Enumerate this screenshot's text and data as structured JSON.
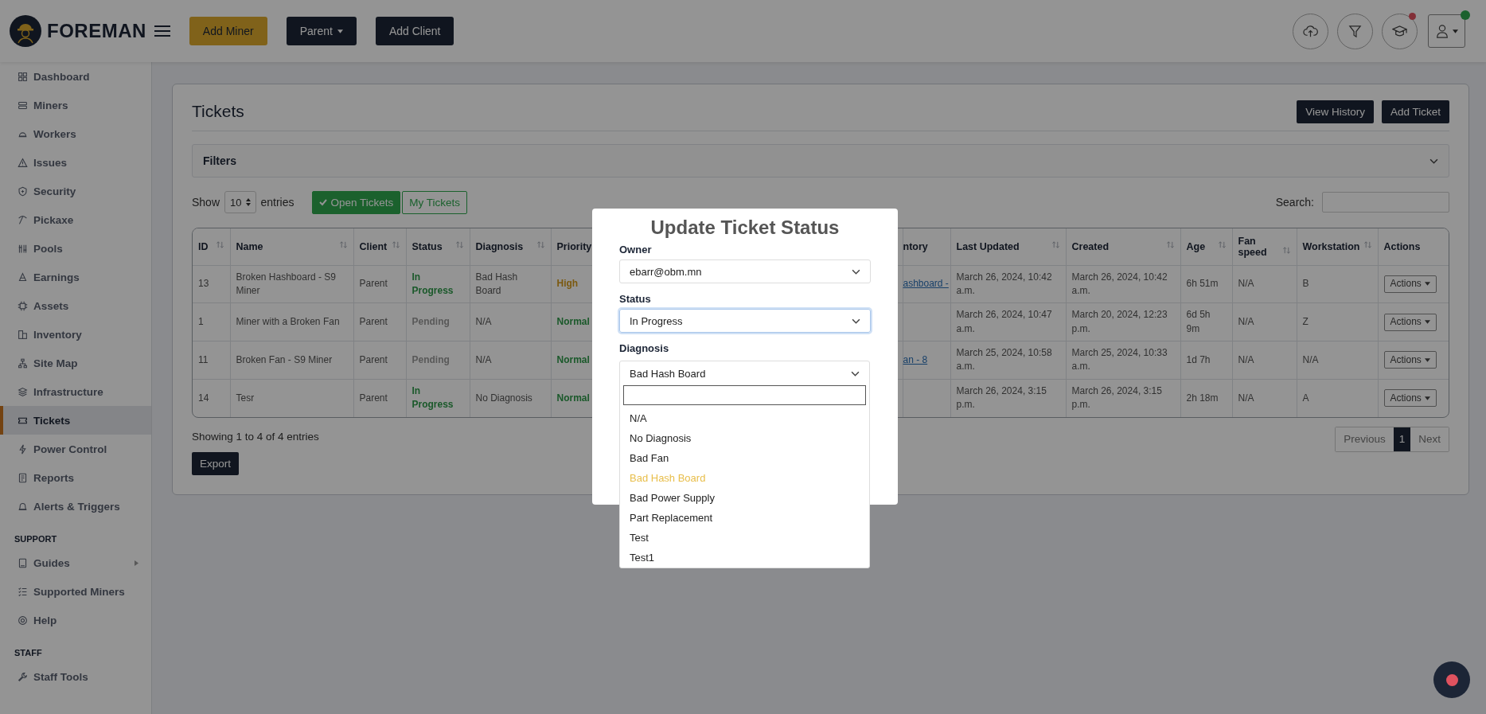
{
  "header": {
    "brand": "FOREMAN",
    "buttons": [
      {
        "label": "Add Miner",
        "kind": "accent"
      },
      {
        "label": "Parent",
        "kind": "dropdown"
      },
      {
        "label": "Add Client",
        "kind": "dark"
      }
    ],
    "notifications": {
      "unread": true
    },
    "user": {
      "online": true
    }
  },
  "sidebar": {
    "sections": [
      {
        "items": [
          {
            "label": "Dashboard",
            "selected": false,
            "expandable": false
          },
          {
            "label": "Miners",
            "selected": false,
            "expandable": false
          },
          {
            "label": "Workers",
            "selected": false,
            "expandable": false
          },
          {
            "label": "Issues",
            "selected": false,
            "expandable": false
          },
          {
            "label": "Security",
            "selected": false,
            "expandable": false
          },
          {
            "label": "Pickaxe",
            "selected": false,
            "expandable": false
          },
          {
            "label": "Pools",
            "selected": false,
            "expandable": false
          },
          {
            "label": "Earnings",
            "selected": false,
            "expandable": false
          },
          {
            "label": "Assets",
            "selected": false,
            "expandable": false
          },
          {
            "label": "Inventory",
            "selected": false,
            "expandable": false
          },
          {
            "label": "Site Map",
            "selected": false,
            "expandable": false
          },
          {
            "label": "Infrastructure",
            "selected": false,
            "expandable": false
          },
          {
            "label": "Tickets",
            "selected": true,
            "expandable": false
          },
          {
            "label": "Power Control",
            "selected": false,
            "expandable": false
          },
          {
            "label": "Reports",
            "selected": false,
            "expandable": false
          },
          {
            "label": "Alerts & Triggers",
            "selected": false,
            "expandable": false
          }
        ]
      },
      {
        "heading": "SUPPORT",
        "items": [
          {
            "label": "Guides",
            "selected": false,
            "expandable": true
          },
          {
            "label": "Supported Miners",
            "selected": false,
            "expandable": false
          },
          {
            "label": "Help",
            "selected": false,
            "expandable": false
          }
        ]
      },
      {
        "heading": "STAFF",
        "items": [
          {
            "label": "Staff Tools",
            "selected": false,
            "expandable": false
          }
        ]
      }
    ]
  },
  "page": {
    "title": "Tickets",
    "actions": [
      "View History",
      "Add Ticket"
    ],
    "filters_label": "Filters",
    "show_label": "Show",
    "page_size": "10",
    "entries_label": "entries",
    "toggles": [
      {
        "label": "Open Tickets",
        "selected": true
      },
      {
        "label": "My Tickets",
        "selected": false
      }
    ],
    "search_label": "Search:"
  },
  "table": {
    "columns": [
      {
        "label": "ID",
        "sortable": true
      },
      {
        "label": "Name",
        "sortable": true
      },
      {
        "label": "Client",
        "sortable": true
      },
      {
        "label": "Status",
        "sortable": true
      },
      {
        "label": "Diagnosis",
        "sortable": true
      },
      {
        "label": "Priority"
      },
      {
        "label": "ntory"
      },
      {
        "label": "Last Updated",
        "sortable": true
      },
      {
        "label": "Created",
        "sortable": true
      },
      {
        "label": "Age",
        "sortable": true
      },
      {
        "label": "Fan speed",
        "sortable": true
      },
      {
        "label": "Workstation",
        "sortable": true
      },
      {
        "label": "Actions",
        "sortable": false
      }
    ],
    "rows": [
      {
        "id": "13",
        "name": "Broken Hashboard - S9 Miner",
        "client": "Parent",
        "status": {
          "text": "In Progress",
          "kind": "in_progress"
        },
        "diagnosis": "Bad Hash Board",
        "priority": {
          "text": "High",
          "kind": "high"
        },
        "inventory": "ashboard -",
        "last_updated": "March 26, 2024, 10:42 a.m.",
        "created": "March 26, 2024, 10:42 a.m.",
        "age": "6h 51m",
        "fan_speed": "N/A",
        "workstation": "B",
        "action": "Actions"
      },
      {
        "id": "1",
        "name": "Miner with a Broken Fan",
        "client": "Parent",
        "status": {
          "text": "Pending",
          "kind": "pending"
        },
        "diagnosis": "N/A",
        "priority": {
          "text": "Normal",
          "kind": "normal"
        },
        "last_updated": "March 26, 2024, 10:47 a.m.",
        "created": "March 20, 2024, 12:23 p.m.",
        "age": "6d 5h 9m",
        "fan_speed": "N/A",
        "workstation": "Z",
        "action": "Actions"
      },
      {
        "id": "11",
        "name": "Broken Fan - S9 Miner",
        "client": "Parent",
        "status": {
          "text": "Pending",
          "kind": "pending"
        },
        "diagnosis": "N/A",
        "priority": {
          "text": "Normal",
          "kind": "normal"
        },
        "inventory": "an - 8",
        "last_updated": "March 25, 2024, 10:58 a.m.",
        "created": "March 25, 2024, 10:33 a.m.",
        "age": "1d 7h",
        "fan_speed": "N/A",
        "workstation": "N/A",
        "action": "Actions"
      },
      {
        "id": "14",
        "name": "Tesr",
        "client": "Parent",
        "status": {
          "text": "In Progress",
          "kind": "in_progress"
        },
        "diagnosis": "No Diagnosis",
        "priority": {
          "text": "Normal",
          "kind": "normal"
        },
        "last_updated": "March 26, 2024, 3:15 p.m.",
        "created": "March 26, 2024, 3:15 p.m.",
        "age": "2h 18m",
        "fan_speed": "N/A",
        "workstation": "A",
        "action": "Actions"
      }
    ]
  },
  "footer": {
    "summary": "Showing 1 to 4 of 4 entries",
    "pagination": [
      {
        "label": "Previous",
        "selected": false
      },
      {
        "label": "1",
        "selected": true
      },
      {
        "label": "Next",
        "selected": false
      }
    ],
    "export": "Export"
  },
  "modal": {
    "title": "Update Ticket Status",
    "owner": {
      "label": "Owner",
      "value": "ebarr@obm.mn"
    },
    "status": {
      "label": "Status",
      "value": "In Progress",
      "focused": true
    },
    "diagnosis": {
      "label": "Diagnosis",
      "value": "Bad Hash Board",
      "expanded": true,
      "options": [
        {
          "label": "N/A",
          "selected": false
        },
        {
          "label": "No Diagnosis",
          "selected": false
        },
        {
          "label": "Bad Fan",
          "selected": false
        },
        {
          "label": "Bad Hash Board",
          "selected": true
        },
        {
          "label": "Bad Power Supply",
          "selected": false
        },
        {
          "label": "Part Replacement",
          "selected": false
        },
        {
          "label": "Test",
          "selected": false
        },
        {
          "label": "Test1",
          "selected": false
        }
      ]
    }
  }
}
